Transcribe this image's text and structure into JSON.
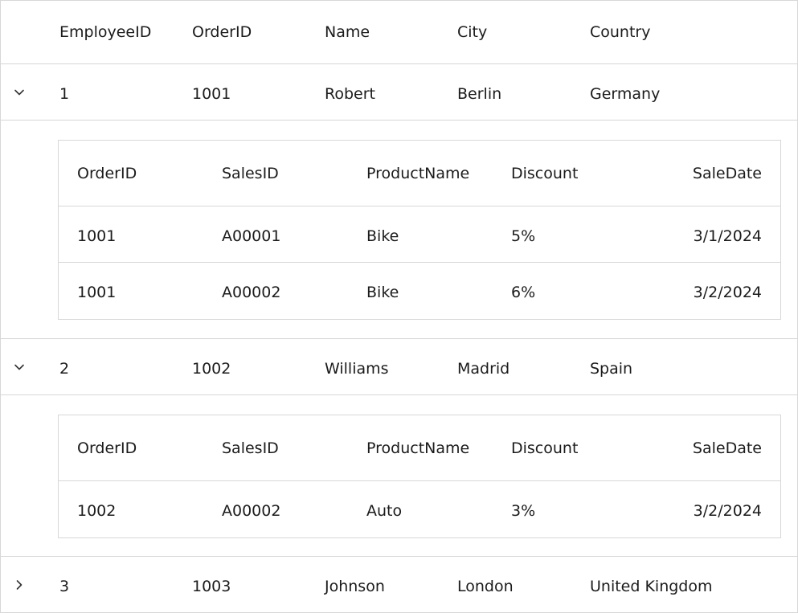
{
  "columns": {
    "employee_id": "EmployeeID",
    "order_id": "OrderID",
    "name": "Name",
    "city": "City",
    "country": "Country"
  },
  "detail_columns": {
    "order_id": "OrderID",
    "sales_id": "SalesID",
    "product_name": "ProductName",
    "discount": "Discount",
    "sale_date": "SaleDate"
  },
  "rows": [
    {
      "employee_id": "1",
      "order_id": "1001",
      "name": "Robert",
      "city": "Berlin",
      "country": "Germany",
      "expanded": true,
      "details": [
        {
          "order_id": "1001",
          "sales_id": "A00001",
          "product_name": "Bike",
          "discount": "5%",
          "sale_date": "3/1/2024"
        },
        {
          "order_id": "1001",
          "sales_id": "A00002",
          "product_name": "Bike",
          "discount": "6%",
          "sale_date": "3/2/2024"
        }
      ]
    },
    {
      "employee_id": "2",
      "order_id": "1002",
      "name": "Williams",
      "city": "Madrid",
      "country": "Spain",
      "expanded": true,
      "details": [
        {
          "order_id": "1002",
          "sales_id": "A00002",
          "product_name": "Auto",
          "discount": "3%",
          "sale_date": "3/2/2024"
        }
      ]
    },
    {
      "employee_id": "3",
      "order_id": "1003",
      "name": "Johnson",
      "city": "London",
      "country": "United Kingdom",
      "expanded": false,
      "details": []
    }
  ],
  "icons": {
    "expanded": "chevron-down-icon",
    "collapsed": "chevron-right-icon"
  }
}
